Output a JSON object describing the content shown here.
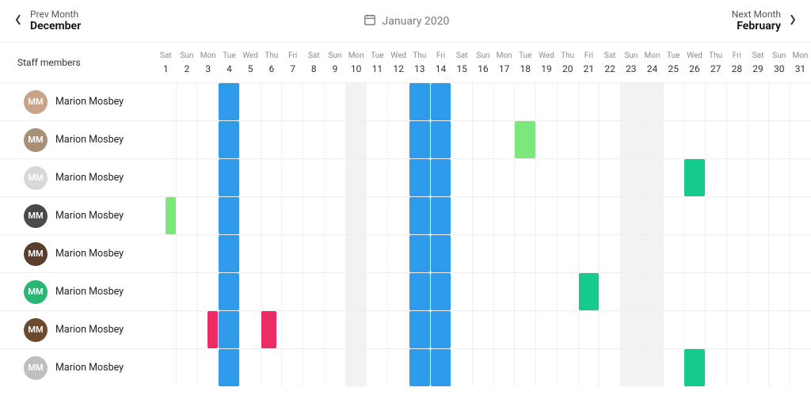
{
  "nav": {
    "prev_label": "Prev Month",
    "prev_month": "December",
    "next_label": "Next Month",
    "next_month": "February",
    "current": "January 2020"
  },
  "left_header": "Staff members",
  "days": [
    {
      "dow": "Sat",
      "n": "1"
    },
    {
      "dow": "Sun",
      "n": "2"
    },
    {
      "dow": "Mon",
      "n": "3"
    },
    {
      "dow": "Tue",
      "n": "4"
    },
    {
      "dow": "Wed",
      "n": "5"
    },
    {
      "dow": "Thu",
      "n": "6"
    },
    {
      "dow": "Fri",
      "n": "7"
    },
    {
      "dow": "Sat",
      "n": "8"
    },
    {
      "dow": "Sun",
      "n": "9"
    },
    {
      "dow": "Mon",
      "n": "10"
    },
    {
      "dow": "Tue",
      "n": "11"
    },
    {
      "dow": "Wed",
      "n": "12"
    },
    {
      "dow": "Thu",
      "n": "13"
    },
    {
      "dow": "Fri",
      "n": "14"
    },
    {
      "dow": "Sat",
      "n": "15"
    },
    {
      "dow": "Sun",
      "n": "16"
    },
    {
      "dow": "Mon",
      "n": "17"
    },
    {
      "dow": "Tue",
      "n": "18"
    },
    {
      "dow": "Wed",
      "n": "19"
    },
    {
      "dow": "Thu",
      "n": "20"
    },
    {
      "dow": "Fri",
      "n": "21"
    },
    {
      "dow": "Sat",
      "n": "22"
    },
    {
      "dow": "Sun",
      "n": "23"
    },
    {
      "dow": "Mon",
      "n": "24"
    },
    {
      "dow": "Tue",
      "n": "25"
    },
    {
      "dow": "Wed",
      "n": "26"
    },
    {
      "dow": "Thu",
      "n": "27"
    },
    {
      "dow": "Fri",
      "n": "28"
    },
    {
      "dow": "Sat",
      "n": "29"
    },
    {
      "dow": "Sun",
      "n": "30"
    },
    {
      "dow": "Mon",
      "n": "31"
    }
  ],
  "shaded_days": [
    10,
    23,
    24
  ],
  "colors": {
    "blue": "#2F9BEB",
    "green": "#16C98D",
    "lightgreen": "#7CE87C",
    "pink": "#EC2D63"
  },
  "avatar_colors": [
    "#c9a38a",
    "#a89078",
    "#d8d8d8",
    "#4a4a4a",
    "#5a3d2e",
    "#2bb673",
    "#6b4a2e",
    "#bfbfbf"
  ],
  "staff": [
    {
      "name": "Marion Mosbey",
      "blocks": [
        {
          "day": 4,
          "w": 1,
          "color": "blue",
          "shape": "full"
        },
        {
          "day": 13,
          "w": 2,
          "color": "blue",
          "shape": "full"
        }
      ]
    },
    {
      "name": "Marion Mosbey",
      "blocks": [
        {
          "day": 4,
          "w": 1,
          "color": "blue",
          "shape": "full"
        },
        {
          "day": 13,
          "w": 2,
          "color": "blue",
          "shape": "full"
        },
        {
          "day": 18,
          "w": 1,
          "color": "lightgreen",
          "shape": "full"
        }
      ]
    },
    {
      "name": "Marion Mosbey",
      "blocks": [
        {
          "day": 4,
          "w": 1,
          "color": "blue",
          "shape": "full"
        },
        {
          "day": 13,
          "w": 2,
          "color": "blue",
          "shape": "full"
        },
        {
          "day": 26,
          "w": 1,
          "color": "green",
          "shape": "full"
        }
      ]
    },
    {
      "name": "Marion Mosbey",
      "blocks": [
        {
          "day": 1,
          "w": 1,
          "color": "lightgreen",
          "shape": "right-half"
        },
        {
          "day": 4,
          "w": 1,
          "color": "blue",
          "shape": "full"
        },
        {
          "day": 13,
          "w": 2,
          "color": "blue",
          "shape": "full"
        }
      ]
    },
    {
      "name": "Marion Mosbey",
      "blocks": [
        {
          "day": 4,
          "w": 1,
          "color": "blue",
          "shape": "full"
        },
        {
          "day": 13,
          "w": 2,
          "color": "blue",
          "shape": "full"
        }
      ]
    },
    {
      "name": "Marion Mosbey",
      "blocks": [
        {
          "day": 4,
          "w": 1,
          "color": "blue",
          "shape": "full"
        },
        {
          "day": 13,
          "w": 2,
          "color": "blue",
          "shape": "full"
        },
        {
          "day": 21,
          "w": 1,
          "color": "green",
          "shape": "full"
        }
      ]
    },
    {
      "name": "Marion Mosbey",
      "blocks": [
        {
          "day": 3,
          "w": 1,
          "color": "pink",
          "shape": "right-half"
        },
        {
          "day": 4,
          "w": 1,
          "color": "blue",
          "shape": "full"
        },
        {
          "day": 6,
          "w": 1,
          "color": "pink",
          "shape": "left-three-quarter"
        },
        {
          "day": 13,
          "w": 2,
          "color": "blue",
          "shape": "full"
        }
      ]
    },
    {
      "name": "Marion Mosbey",
      "blocks": [
        {
          "day": 4,
          "w": 1,
          "color": "blue",
          "shape": "full"
        },
        {
          "day": 13,
          "w": 2,
          "color": "blue",
          "shape": "full"
        },
        {
          "day": 26,
          "w": 1,
          "color": "green",
          "shape": "full"
        }
      ]
    }
  ]
}
